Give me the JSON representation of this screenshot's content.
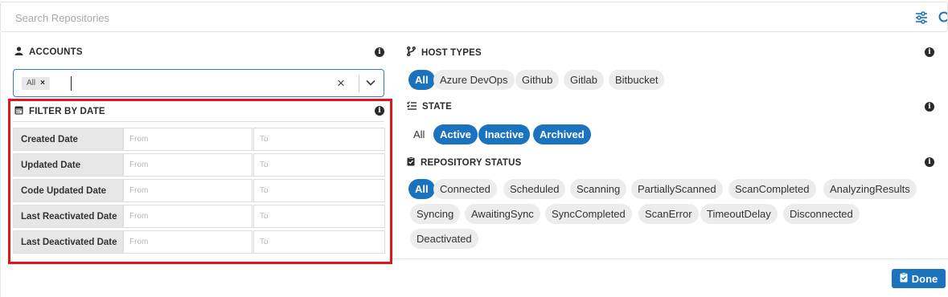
{
  "search": {
    "placeholder": "Search Repositories"
  },
  "accounts": {
    "title": "ACCOUNTS",
    "selected_chip": "All",
    "chip_remove": "×",
    "clear_symbol": "×"
  },
  "filter_by_date": {
    "title": "FILTER BY DATE",
    "rows": [
      {
        "label": "Created Date",
        "from_placeholder": "From",
        "to_placeholder": "To"
      },
      {
        "label": "Updated Date",
        "from_placeholder": "From",
        "to_placeholder": "To"
      },
      {
        "label": "Code Updated Date",
        "from_placeholder": "From",
        "to_placeholder": "To"
      },
      {
        "label": "Last Reactivated Date",
        "from_placeholder": "From",
        "to_placeholder": "To"
      },
      {
        "label": "Last Deactivated Date",
        "from_placeholder": "From",
        "to_placeholder": "To"
      }
    ]
  },
  "host_types": {
    "title": "HOST TYPES",
    "options": [
      "All",
      "Azure DevOps",
      "Github",
      "Gitlab",
      "Bitbucket"
    ],
    "selected": [
      "All"
    ]
  },
  "state": {
    "title": "STATE",
    "options": [
      "All",
      "Active",
      "Inactive",
      "Archived"
    ],
    "selected": [
      "Active",
      "Inactive",
      "Archived"
    ]
  },
  "repository_status": {
    "title": "REPOSITORY STATUS",
    "options": [
      "All",
      "Connected",
      "Scheduled",
      "Scanning",
      "PartiallyScanned",
      "ScanCompleted",
      "AnalyzingResults",
      "Syncing",
      "AwaitingSync",
      "SyncCompleted",
      "ScanError",
      "TimeoutDelay",
      "Disconnected",
      "Deactivated"
    ],
    "selected": [
      "All"
    ]
  },
  "done_button": {
    "label": "Done"
  },
  "info_symbol": "i",
  "colors": {
    "accent": "#1b73be",
    "highlight_border": "#e0161c",
    "label_bg": "#e6e6e6"
  }
}
